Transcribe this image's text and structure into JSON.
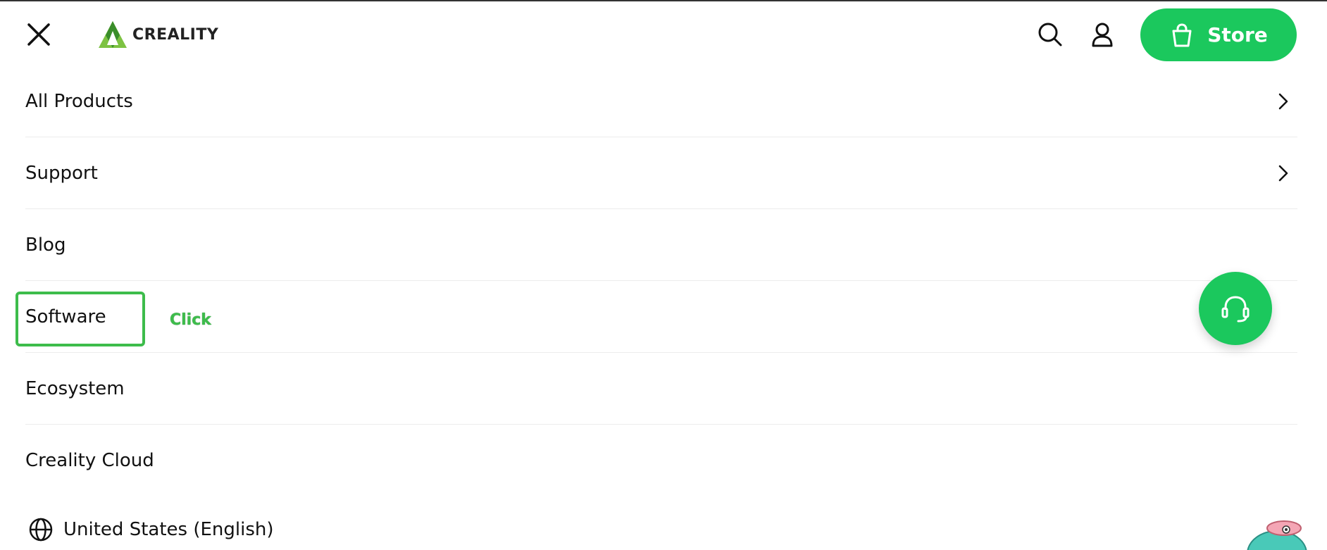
{
  "header": {
    "logo_text": "CREALITY",
    "store_label": "Store"
  },
  "menu": {
    "items": [
      {
        "label": "All Products",
        "has_chevron": true
      },
      {
        "label": "Support",
        "has_chevron": true
      },
      {
        "label": "Blog",
        "has_chevron": false
      },
      {
        "label": "Software",
        "has_chevron": false
      },
      {
        "label": "Ecosystem",
        "has_chevron": false
      },
      {
        "label": "Creality Cloud",
        "has_chevron": false
      }
    ]
  },
  "annotation": {
    "click_label": "Click"
  },
  "locale": {
    "label": "United States (English)"
  },
  "colors": {
    "brand_green": "#1bc85d",
    "highlight_green": "#3dbc4b"
  },
  "icons": [
    "close-icon",
    "creality-logo-icon",
    "search-icon",
    "user-icon",
    "shopping-bag-icon",
    "chevron-right-icon",
    "headset-icon",
    "globe-icon",
    "mascot-icon"
  ]
}
